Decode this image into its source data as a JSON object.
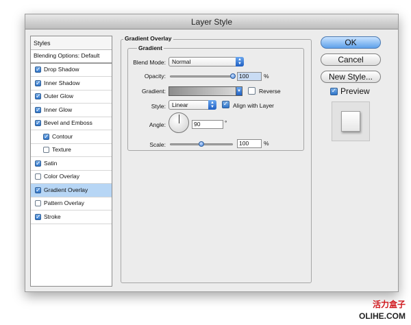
{
  "window": {
    "title": "Layer Style"
  },
  "styles_panel": {
    "header": "Styles",
    "items": [
      {
        "label": "Blending Options: Default",
        "checkbox": false,
        "checked": false,
        "selected": false,
        "indent": false
      },
      {
        "label": "Drop Shadow",
        "checkbox": true,
        "checked": true,
        "selected": false,
        "indent": false
      },
      {
        "label": "Inner Shadow",
        "checkbox": true,
        "checked": true,
        "selected": false,
        "indent": false
      },
      {
        "label": "Outer Glow",
        "checkbox": true,
        "checked": true,
        "selected": false,
        "indent": false
      },
      {
        "label": "Inner Glow",
        "checkbox": true,
        "checked": true,
        "selected": false,
        "indent": false
      },
      {
        "label": "Bevel and Emboss",
        "checkbox": true,
        "checked": true,
        "selected": false,
        "indent": false
      },
      {
        "label": "Contour",
        "checkbox": true,
        "checked": true,
        "selected": false,
        "indent": true
      },
      {
        "label": "Texture",
        "checkbox": true,
        "checked": false,
        "selected": false,
        "indent": true
      },
      {
        "label": "Satin",
        "checkbox": true,
        "checked": true,
        "selected": false,
        "indent": false
      },
      {
        "label": "Color Overlay",
        "checkbox": true,
        "checked": false,
        "selected": false,
        "indent": false
      },
      {
        "label": "Gradient Overlay",
        "checkbox": true,
        "checked": true,
        "selected": true,
        "indent": false
      },
      {
        "label": "Pattern Overlay",
        "checkbox": true,
        "checked": false,
        "selected": false,
        "indent": false
      },
      {
        "label": "Stroke",
        "checkbox": true,
        "checked": true,
        "selected": false,
        "indent": false
      }
    ]
  },
  "gradient_overlay": {
    "section_title": "Gradient Overlay",
    "group_title": "Gradient",
    "blend_mode": {
      "label": "Blend Mode:",
      "value": "Normal"
    },
    "opacity": {
      "label": "Opacity:",
      "value": "100",
      "unit": "%",
      "level": 1.0
    },
    "gradient": {
      "label": "Gradient:",
      "reverse_label": "Reverse",
      "reverse_checked": false
    },
    "style": {
      "label": "Style:",
      "value": "Linear",
      "align_label": "Align with Layer",
      "align_checked": true
    },
    "angle": {
      "label": "Angle:",
      "value": "90",
      "unit": "°"
    },
    "scale": {
      "label": "Scale:",
      "value": "100",
      "unit": "%",
      "level": 0.5
    }
  },
  "buttons": {
    "ok": "OK",
    "cancel": "Cancel",
    "new_style": "New Style...",
    "preview": "Preview",
    "preview_checked": true
  },
  "watermark": {
    "line1": "活力盒子",
    "line2": "OLIHE.COM"
  },
  "colors": {
    "selection": "#b7d6f5",
    "accent_blue": "#3d7fd8"
  }
}
